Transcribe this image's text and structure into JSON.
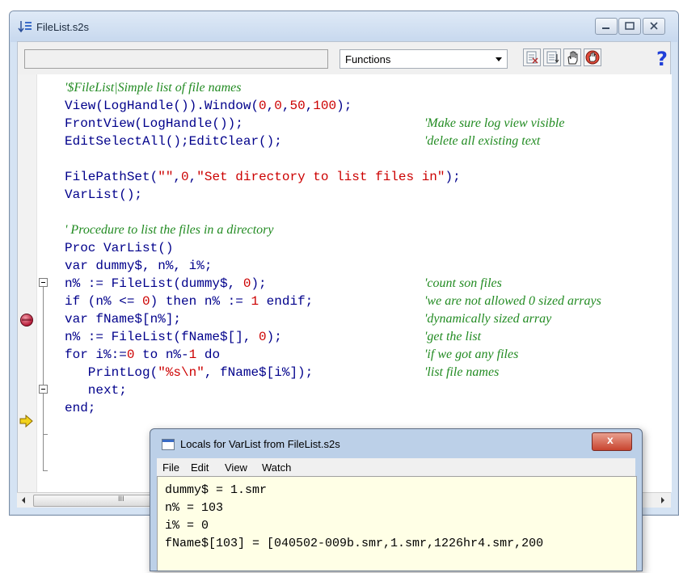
{
  "window": {
    "title": "FileList.s2s"
  },
  "toolbar": {
    "combo_value": "Functions",
    "help_label": "?"
  },
  "code": [
    {
      "tokens": [],
      "comment": "'$FileList|Simple list of file names"
    },
    {
      "tokens": [
        [
          "View(LogHandle()).Window(",
          "k"
        ],
        [
          "0",
          "n"
        ],
        [
          ",",
          "k"
        ],
        [
          "0",
          "n"
        ],
        [
          ",",
          "k"
        ],
        [
          "50",
          "n"
        ],
        [
          ",",
          "k"
        ],
        [
          "100",
          "n"
        ],
        [
          ");",
          "k"
        ]
      ],
      "comment": ""
    },
    {
      "tokens": [
        [
          "FrontView(LogHandle());",
          "k"
        ]
      ],
      "comment": "'Make sure log view visible"
    },
    {
      "tokens": [
        [
          "EditSelectAll();EditClear();",
          "k"
        ]
      ],
      "comment": "'delete all existing text"
    },
    {
      "tokens": [],
      "comment": ""
    },
    {
      "tokens": [
        [
          "FilePathSet(",
          "k"
        ],
        [
          "\"\"",
          "s"
        ],
        [
          ",",
          "k"
        ],
        [
          "0",
          "n"
        ],
        [
          ",",
          "k"
        ],
        [
          "\"Set directory to list files in\"",
          "s"
        ],
        [
          ");",
          "k"
        ]
      ],
      "comment": ""
    },
    {
      "tokens": [
        [
          "VarList();",
          "k"
        ]
      ],
      "comment": ""
    },
    {
      "tokens": [],
      "comment": ""
    },
    {
      "tokens": [],
      "comment": "' Procedure to list the files in a directory"
    },
    {
      "tokens": [
        [
          "Proc VarList()",
          "k"
        ]
      ],
      "comment": ""
    },
    {
      "tokens": [
        [
          "var dummy$, n%, i%;",
          "k"
        ]
      ],
      "comment": ""
    },
    {
      "tokens": [
        [
          "n% := FileList(dummy$, ",
          "k"
        ],
        [
          "0",
          "n"
        ],
        [
          ");",
          "k"
        ]
      ],
      "comment": "'count son files"
    },
    {
      "tokens": [
        [
          "if (n% <= ",
          "k"
        ],
        [
          "0",
          "n"
        ],
        [
          ") then n% := ",
          "k"
        ],
        [
          "1",
          "n"
        ],
        [
          " endif;",
          "k"
        ]
      ],
      "comment": "'we are not allowed 0 sized arrays"
    },
    {
      "tokens": [
        [
          "var fName$[n%];",
          "k"
        ]
      ],
      "comment": "'dynamically sized array"
    },
    {
      "tokens": [
        [
          "n% := FileList(fName$[], ",
          "k"
        ],
        [
          "0",
          "n"
        ],
        [
          ");",
          "k"
        ]
      ],
      "comment": "'get the list"
    },
    {
      "tokens": [
        [
          "for i%:=",
          "k"
        ],
        [
          "0",
          "n"
        ],
        [
          " to n%-",
          "k"
        ],
        [
          "1",
          "n"
        ],
        [
          " do",
          "k"
        ]
      ],
      "comment": "'if we got any files"
    },
    {
      "tokens": [
        [
          "   PrintLog(",
          "k"
        ],
        [
          "\"%s\\n\"",
          "s"
        ],
        [
          ", fName$[i%]);",
          "k"
        ]
      ],
      "comment": "'list file names"
    },
    {
      "tokens": [
        [
          "   next;",
          "k"
        ]
      ],
      "comment": ""
    },
    {
      "tokens": [
        [
          "end;",
          "k"
        ]
      ],
      "comment": ""
    }
  ],
  "scrollbar": {
    "grip": "III"
  },
  "locals": {
    "title": "Locals for VarList from FileList.s2s",
    "close_label": "x",
    "menu": [
      "File",
      "Edit",
      "View",
      "Watch"
    ],
    "lines": [
      "dummy$ = 1.smr",
      "n% = 103",
      "i% = 0",
      "fName$[103] = [040502-009b.smr,1.smr,1226hr4.smr,200"
    ]
  },
  "colors": {
    "keyword": "#00008b",
    "string": "#cc0000",
    "comment": "#228b22",
    "breakpoint": "#c8173a",
    "exec_arrow": "#f2d21b"
  }
}
